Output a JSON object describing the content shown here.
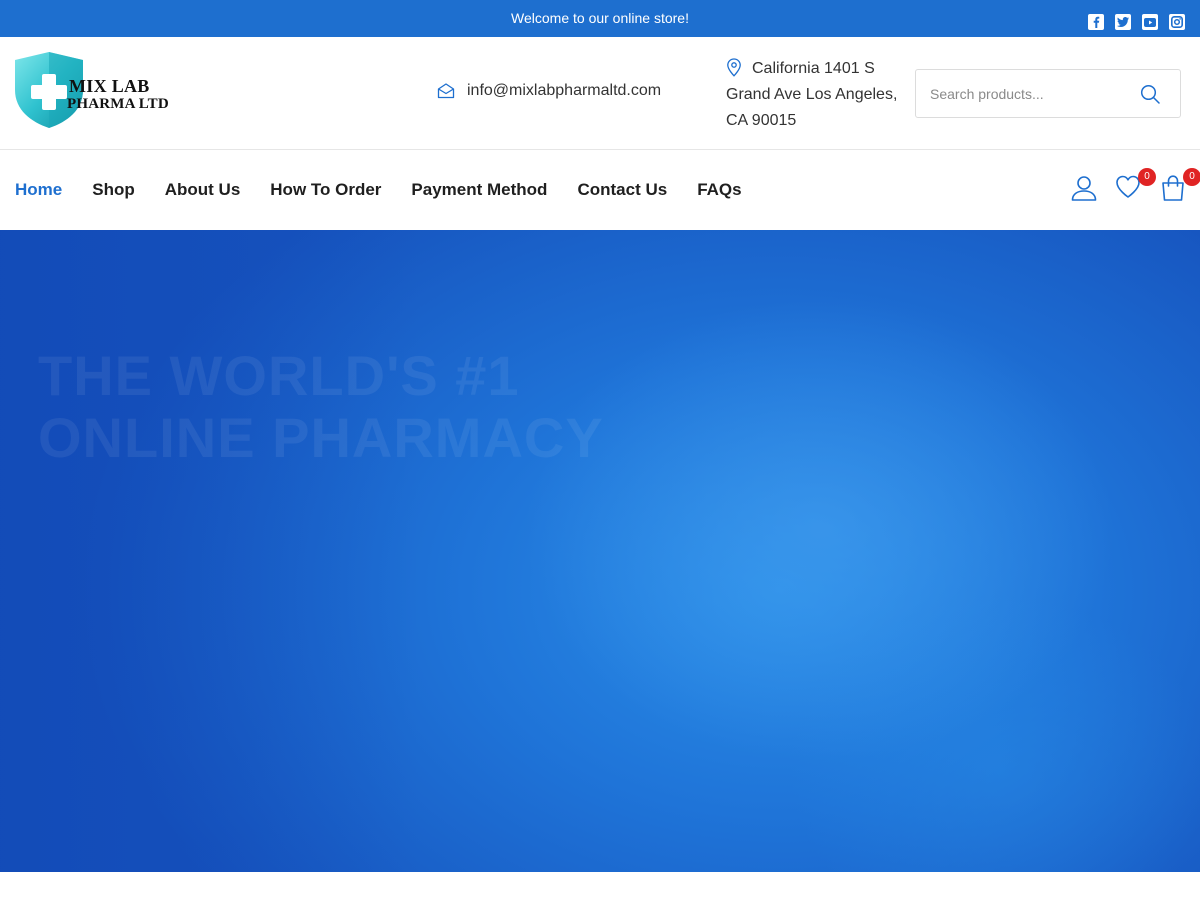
{
  "topbar": {
    "welcome": "Welcome to our online store!",
    "social": [
      "facebook-icon",
      "twitter-icon",
      "youtube-icon",
      "instagram-icon"
    ],
    "bg_color": "#1e6fcf"
  },
  "header": {
    "logo": {
      "line1": "MIX LAB",
      "line2": "PHARMA LTD"
    },
    "email": "info@mixlabpharmaltd.com",
    "address": {
      "line1": "California 1401 S",
      "line2": "Grand Ave Los Angeles,",
      "line3": "CA 90015"
    },
    "search": {
      "placeholder": "Search products..."
    }
  },
  "nav": {
    "items": [
      {
        "label": "Home",
        "active": true
      },
      {
        "label": "Shop"
      },
      {
        "label": "About Us"
      },
      {
        "label": "How To Order"
      },
      {
        "label": "Payment Method"
      },
      {
        "label": "Contact Us"
      },
      {
        "label": "FAQs"
      }
    ],
    "wishlist_count": "0",
    "cart_count": "0",
    "accent_color": "#1e6fcf",
    "badge_color": "#e02424"
  },
  "hero": {
    "title_line1": "THE WORLD'S #1",
    "title_line2": "ONLINE PHARMACY"
  }
}
